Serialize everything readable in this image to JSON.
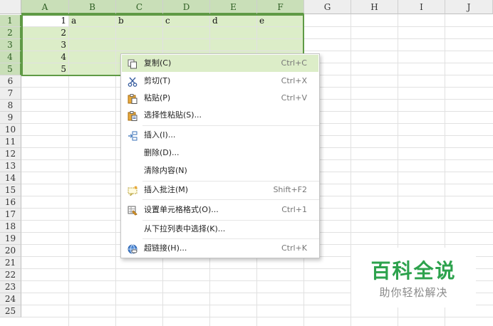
{
  "spreadsheet": {
    "columns": [
      "A",
      "B",
      "C",
      "D",
      "E",
      "F",
      "G",
      "H",
      "I",
      "J"
    ],
    "selected_columns": [
      "A",
      "B",
      "C",
      "D",
      "E",
      "F"
    ],
    "rows": [
      "1",
      "2",
      "3",
      "4",
      "5",
      "6",
      "7",
      "8",
      "9",
      "10",
      "11",
      "12",
      "13",
      "14",
      "15",
      "16",
      "17",
      "18",
      "19",
      "20",
      "21",
      "22",
      "23",
      "24",
      "25"
    ],
    "selected_rows": [
      "1",
      "2",
      "3",
      "4",
      "5"
    ],
    "cells": {
      "A1": "1",
      "A2": "2",
      "A3": "3",
      "A4": "4",
      "A5": "5",
      "B1": "a",
      "C1": "b",
      "D1": "c",
      "E1": "d",
      "F1": "e"
    },
    "selection_color": "#dcedc8",
    "selection_border_color": "#5f9a45"
  },
  "context_menu": {
    "items": [
      {
        "label": "复制(C)",
        "shortcut": "Ctrl+C",
        "icon": "copy-icon"
      },
      {
        "label": "剪切(T)",
        "shortcut": "Ctrl+X",
        "icon": "scissors-icon"
      },
      {
        "label": "粘贴(P)",
        "shortcut": "Ctrl+V",
        "icon": "paste-icon"
      },
      {
        "label": "选择性粘贴(S)...",
        "shortcut": "",
        "icon": "paste-special-icon"
      },
      {
        "label": "插入(I)...",
        "shortcut": "",
        "icon": "insert-icon"
      },
      {
        "label": "删除(D)...",
        "shortcut": "",
        "icon": ""
      },
      {
        "label": "清除内容(N)",
        "shortcut": "",
        "icon": ""
      },
      {
        "label": "插入批注(M)",
        "shortcut": "Shift+F2",
        "icon": "comment-icon"
      },
      {
        "label": "设置单元格格式(O)...",
        "shortcut": "Ctrl+1",
        "icon": "format-cells-icon"
      },
      {
        "label": "从下拉列表中选择(K)...",
        "shortcut": "",
        "icon": ""
      },
      {
        "label": "超链接(H)...",
        "shortcut": "Ctrl+K",
        "icon": "hyperlink-icon"
      }
    ]
  },
  "watermark": {
    "title": "百科全说",
    "subtitle": "助你轻松解决",
    "color": "#2da24d"
  }
}
